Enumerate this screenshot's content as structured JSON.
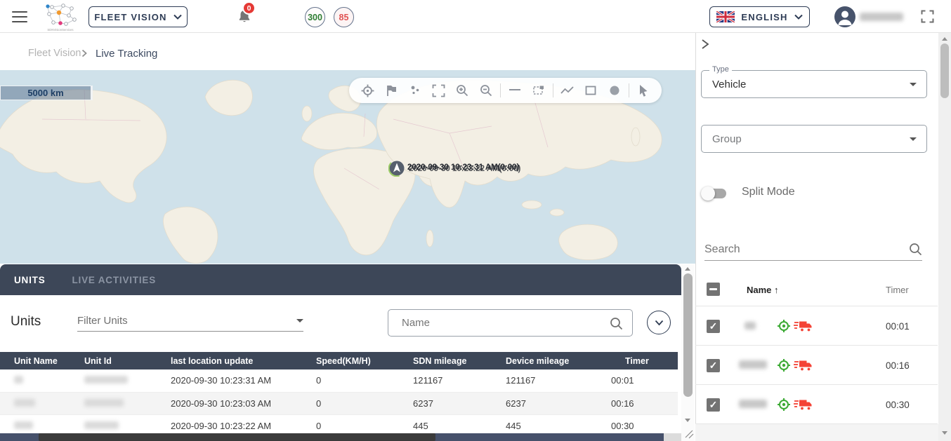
{
  "colors": {
    "brand_navy": "#2e3c55",
    "panel_navy": "#3d4758",
    "badge_red": "#e53935",
    "counter_green": "#2e7d32",
    "counter_red": "#e05252",
    "row_icon_green": "#3daa35",
    "row_icon_red": "#f44336"
  },
  "navbar": {
    "logo_caption": "SDNVisionServices",
    "menu_label": "FLEET VISION",
    "notification_badge": "0",
    "counter_green_value": "300",
    "counter_red_value": "85",
    "language": "ENGLISH"
  },
  "breadcrumb": {
    "parent": "Fleet Vision",
    "current": "Live Tracking"
  },
  "map": {
    "scale_label": "5000 km",
    "marker_label_top": "2020-09-30 10:23:31 AM(0:00)",
    "marker_label_bottom": "2020-09-30 10:23:22 AM(0:00)",
    "toolbar_icons": [
      "locate",
      "flag",
      "cluster",
      "fullscreen",
      "zoom-in",
      "zoom-out",
      "measure-line",
      "select-area",
      "draw-polyline",
      "draw-rectangle",
      "draw-circle",
      "pointer"
    ]
  },
  "units_panel": {
    "tabs": {
      "units": "UNITS",
      "live_activities": "LIVE ACTIVITIES"
    },
    "title": "Units",
    "filter_placeholder": "Filter Units",
    "name_placeholder": "Name",
    "table": {
      "columns": [
        "Unit Name",
        "Unit Id",
        "last location update",
        "Speed(KM/H)",
        "SDN mileage",
        "Device mileage",
        "Timer"
      ],
      "rows": [
        {
          "last_update": "2020-09-30 10:23:31 AM",
          "speed": "0",
          "sdn_mileage": "121167",
          "device_mileage": "121167",
          "timer": "00:01"
        },
        {
          "last_update": "2020-09-30 10:23:03 AM",
          "speed": "0",
          "sdn_mileage": "6237",
          "device_mileage": "6237",
          "timer": "00:16"
        },
        {
          "last_update": "2020-09-30 10:23:22 AM",
          "speed": "0",
          "sdn_mileage": "445",
          "device_mileage": "445",
          "timer": "00:30"
        }
      ]
    }
  },
  "sidebar": {
    "type": {
      "label": "Type",
      "value": "Vehicle"
    },
    "group": {
      "placeholder": "Group"
    },
    "split_mode_label": "Split Mode",
    "search_placeholder": "Search",
    "list": {
      "header": {
        "name": "Name",
        "sort": "↑",
        "timer": "Timer"
      },
      "rows": [
        {
          "timer": "00:01"
        },
        {
          "timer": "00:16"
        },
        {
          "timer": "00:30"
        }
      ]
    }
  }
}
